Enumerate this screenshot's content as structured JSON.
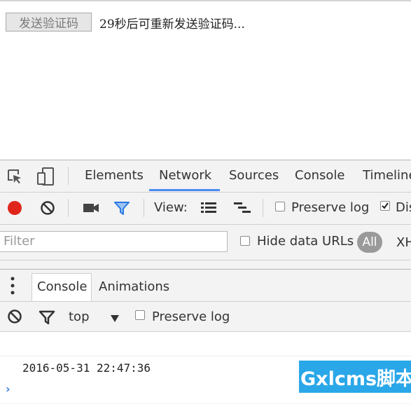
{
  "page": {
    "send_button": "发送验证码",
    "countdown_text": "29秒后可重新发送验证码..."
  },
  "devtools": {
    "tabs": [
      "Elements",
      "Network",
      "Sources",
      "Console",
      "Timeline"
    ],
    "active_tab": "Network",
    "network_toolbar": {
      "view_label": "View:",
      "preserve_log": "Preserve log",
      "disable_cache": "Dis"
    },
    "filter": {
      "placeholder": "Filter",
      "hide_data_urls": "Hide data URLs",
      "all": "All",
      "xhr": "XH"
    },
    "drawer": {
      "tabs": [
        "Console",
        "Animations"
      ],
      "context": "top",
      "preserve_log": "Preserve log"
    },
    "console": {
      "log_line": "2016-05-31 22:47:36",
      "prompt": "›"
    }
  },
  "watermark": {
    "text": "Gxlcms脚本"
  },
  "colors": {
    "accent": "#4a8af4",
    "record": "#e0261b",
    "filter_icon": "#2a7ae2",
    "watermark_bg": "#2aa7e8"
  }
}
